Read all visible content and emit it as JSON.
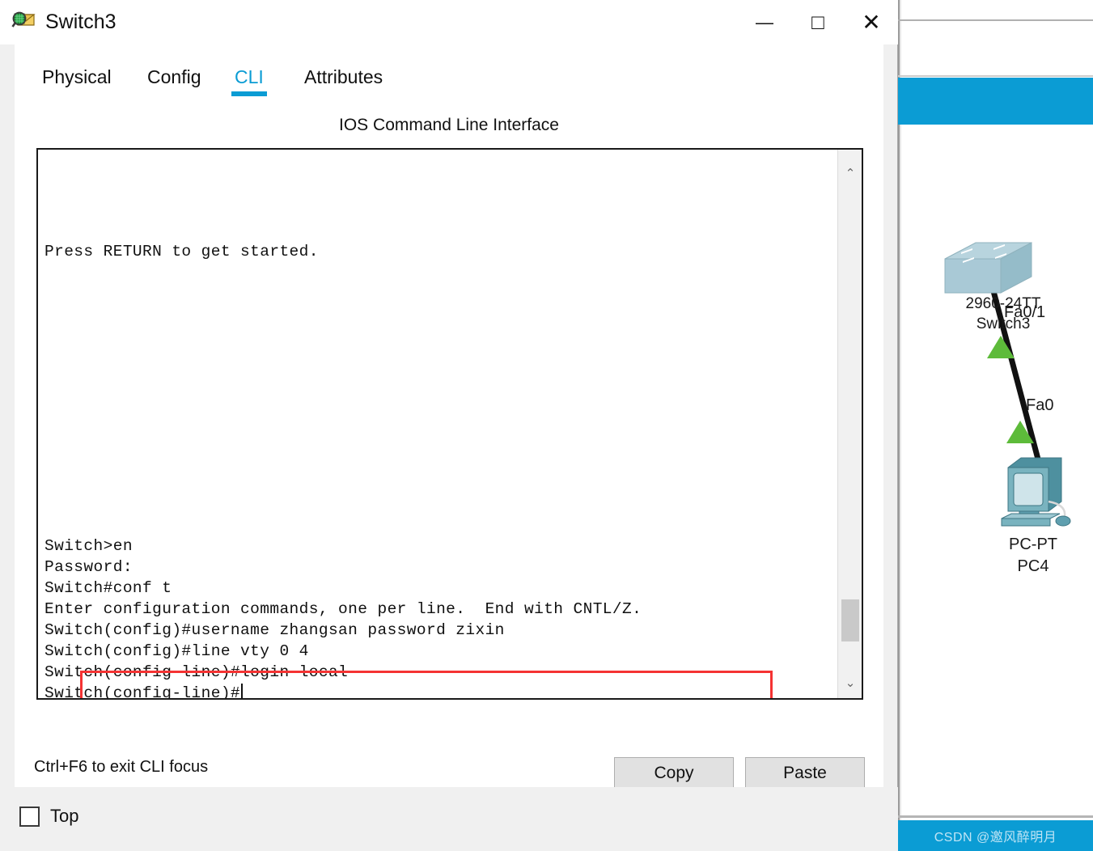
{
  "window": {
    "title": "Switch3",
    "icon": "inspect-envelope-icon",
    "controls": {
      "minimize": "—",
      "maximize": "□",
      "close": "✕"
    }
  },
  "tabs": [
    {
      "label": "Physical",
      "active": false
    },
    {
      "label": "Config",
      "active": false
    },
    {
      "label": "CLI",
      "active": true
    },
    {
      "label": "Attributes",
      "active": false
    }
  ],
  "cli": {
    "heading": "IOS Command Line Interface",
    "intro": "Press RETURN to get started.",
    "session": "Switch>en\nPassword:\nSwitch#conf t\nEnter configuration commands, one per line.  End with CNTL/Z.\nSwitch(config)#username zhangsan password zixin\nSwitch(config)#line vty 0 4\nSwitch(config-line)#login local\nSwitch(config-line)#",
    "lines": [
      "Switch>en",
      "Password:",
      "Switch#conf t",
      "Enter configuration commands, one per line.  End with CNTL/Z.",
      "Switch(config)#username zhangsan password zixin",
      "Switch(config)#line vty 0 4",
      "Switch(config-line)#login local",
      "Switch(config-line)#"
    ],
    "hint": "Ctrl+F6 to exit CLI focus",
    "copy_label": "Copy",
    "paste_label": "Paste",
    "highlight_color": "#f53333",
    "scrollbar": {
      "up_glyph": "⌃",
      "down_glyph": "⌄"
    }
  },
  "footer": {
    "top_label": "Top",
    "top_checked": false
  },
  "workspace": {
    "accent_color": "#0b9cd4",
    "watermark": "CSDN @邀风醉明月",
    "topology": {
      "switch": {
        "model": "2960-24TT",
        "name": "Switch3",
        "port_label": "Fa0/1"
      },
      "pc": {
        "model": "PC-PT",
        "name": "PC4",
        "port_label": "Fa0"
      },
      "link_status_color": "#5dbb3a"
    }
  }
}
